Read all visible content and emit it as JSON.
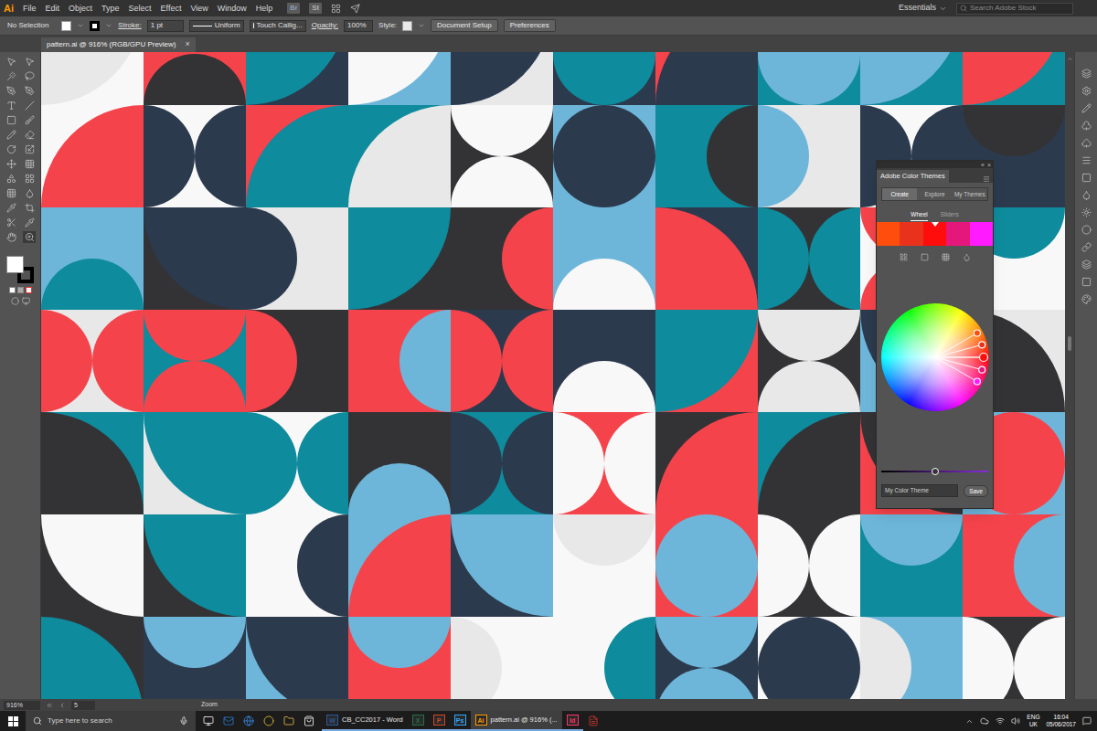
{
  "app": {
    "logo": "Ai",
    "menus": [
      "File",
      "Edit",
      "Object",
      "Type",
      "Select",
      "Effect",
      "View",
      "Window",
      "Help"
    ],
    "bridge": "Br",
    "stock": "St",
    "workspace": "Essentials",
    "stock_search": {
      "placeholder": "Search Adobe Stock"
    }
  },
  "control_bar": {
    "selection": "No Selection",
    "stroke_label": "Stroke:",
    "stroke_weight": "1 pt",
    "profile": "Uniform",
    "brush": "Touch Callig...",
    "opacity_label": "Opacity:",
    "opacity": "100%",
    "style_label": "Style:",
    "buttons": [
      "Document Setup",
      "Preferences"
    ]
  },
  "document_tab": {
    "title": "pattern.ai @ 916% (RGB/GPU Preview)",
    "close": "×"
  },
  "color_themes_panel": {
    "title": "Adobe Color Themes",
    "collapse": "«",
    "close": "×",
    "tabs": [
      {
        "label": "Create",
        "selected": true
      },
      {
        "label": "Explore",
        "selected": false
      },
      {
        "label": "My Themes",
        "selected": false
      }
    ],
    "modes": [
      {
        "label": "Wheel",
        "selected": true
      },
      {
        "label": "Sliders",
        "selected": false
      }
    ],
    "swatches": [
      {
        "color": "#ff4d0d",
        "selected": false
      },
      {
        "color": "#e8321c",
        "selected": false
      },
      {
        "color": "#ff0d0d",
        "selected": true
      },
      {
        "color": "#e6177a",
        "selected": false
      },
      {
        "color": "#ff1aff",
        "selected": false
      }
    ],
    "brightness": {
      "level": 0.5
    },
    "theme_name": "My Color Theme",
    "save": "Save"
  },
  "status_bar": {
    "zoom": "916%",
    "artboard": "5",
    "tool": "Zoom"
  },
  "taskbar": {
    "search_placeholder": "Type here to search",
    "apps": [
      {
        "badge": "W",
        "title": "CB_CC2017 - Word",
        "color": "#2b579a",
        "selected": false
      },
      {
        "badge": "X",
        "title": "",
        "color": "#217346",
        "selected": false
      },
      {
        "badge": "P",
        "title": "",
        "color": "#d24726",
        "selected": false
      },
      {
        "badge": "Ps",
        "title": "",
        "color": "#31a8ff",
        "selected": false
      },
      {
        "badge": "Ai",
        "title": "pattern.ai @ 916% (...",
        "color": "#ff9a00",
        "selected": true
      },
      {
        "badge": "Id",
        "title": "",
        "color": "#ff3366",
        "selected": false
      }
    ],
    "tray": {
      "language": "ENG",
      "region": "UK",
      "time": "16:04",
      "date": "05/06/2017"
    }
  }
}
